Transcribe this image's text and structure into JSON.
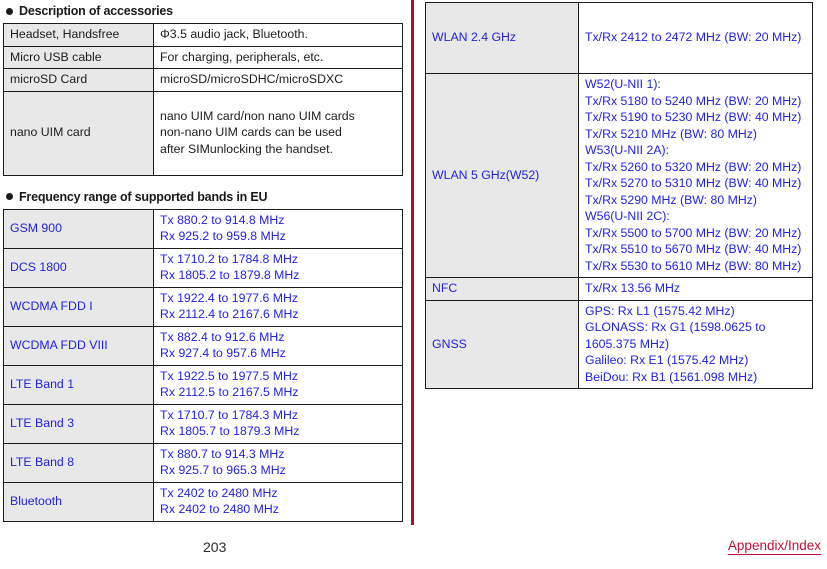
{
  "document": {
    "page_number": "203",
    "footer_link": "Appendix/Index"
  },
  "sections": [
    {
      "heading": "Description of accessories",
      "table": {
        "rows": [
          {
            "label": "Headset, Handsfree",
            "lines": [
              "Φ3.5 audio jack, Bluetooth."
            ]
          },
          {
            "label": "Micro USB cable",
            "lines": [
              "For charging, peripherals, etc."
            ]
          },
          {
            "label": "microSD Card",
            "lines": [
              "microSD/microSDHC/microSDXC"
            ]
          },
          {
            "label": "nano UIM card",
            "lines": [
              "nano UIM card/non nano UIM cards",
              "non-nano UIM cards can be used",
              "after SIMunlocking the handset."
            ]
          }
        ]
      }
    },
    {
      "heading": "Frequency range of supported bands in EU",
      "table": {
        "rows": [
          {
            "label": "GSM 900",
            "lines": [
              "Tx 880.2 to 914.8 MHz",
              "Rx 925.2 to 959.8 MHz"
            ]
          },
          {
            "label": "DCS 1800",
            "lines": [
              "Tx 1710.2 to 1784.8 MHz",
              "Rx 1805.2 to 1879.8 MHz"
            ]
          },
          {
            "label": "WCDMA FDD I",
            "lines": [
              "Tx 1922.4 to 1977.6 MHz",
              "Rx 2112.4 to 2167.6 MHz"
            ]
          },
          {
            "label": "WCDMA FDD VIII",
            "lines": [
              "Tx 882.4 to 912.6 MHz",
              "Rx 927.4 to 957.6 MHz"
            ]
          },
          {
            "label": "LTE Band 1",
            "lines": [
              "Tx 1922.5 to 1977.5 MHz",
              "Rx 2112.5 to 2167.5 MHz"
            ]
          },
          {
            "label": "LTE Band 3",
            "lines": [
              "Tx 1710.7 to 1784.3 MHz",
              "Rx 1805.7 to 1879.3 MHz"
            ]
          },
          {
            "label": "LTE Band 8",
            "lines": [
              "Tx 880.7 to 914.3 MHz",
              "Rx 925.7 to 965.3 MHz"
            ]
          },
          {
            "label": "Bluetooth",
            "lines": [
              "Tx 2402 to 2480 MHz",
              "Rx 2402 to 2480 MHz"
            ]
          }
        ]
      }
    }
  ],
  "radio_bands_table": {
    "rows": [
      {
        "label": "WLAN 2.4 GHz",
        "lines": [
          "Tx/Rx 2412 to 2472 MHz (BW: 20 MHz)"
        ]
      },
      {
        "label": "WLAN 5 GHz(W52)",
        "lines": [
          "W52(U-NII 1):",
          "Tx/Rx 5180 to 5240 MHz (BW: 20 MHz)",
          "Tx/Rx 5190 to 5230 MHz (BW: 40 MHz)",
          "Tx/Rx 5210 MHz (BW: 80 MHz)",
          "W53(U-NII 2A):",
          "Tx/Rx 5260 to 5320 MHz (BW: 20 MHz)",
          "Tx/Rx 5270 to 5310 MHz (BW: 40 MHz)",
          "Tx/Rx 5290 MHz (BW: 80 MHz)",
          "W56(U-NII 2C):",
          "Tx/Rx 5500 to 5700 MHz (BW: 20 MHz)",
          "Tx/Rx 5510 to 5670 MHz (BW: 40 MHz)",
          "Tx/Rx 5530 to 5610 MHz (BW: 80 MHz)"
        ]
      },
      {
        "label": "NFC",
        "lines": [
          "Tx/Rx 13.56 MHz"
        ]
      },
      {
        "label": "GNSS",
        "lines": [
          "GPS: Rx L1 (1575.42 MHz)",
          "GLONASS: Rx G1 (1598.0625 to 1605.375 MHz)",
          "Galileo: Rx E1 (1575.42 MHz)",
          "BeiDou: Rx B1 (1561.098 MHz)"
        ]
      }
    ]
  },
  "colors": {
    "divider": "#ae0e30",
    "link": "#c0103a",
    "table_text_blue": "#2323dd",
    "label_cell_bg": "#e8e8e8",
    "border": "#1c1c1c"
  }
}
